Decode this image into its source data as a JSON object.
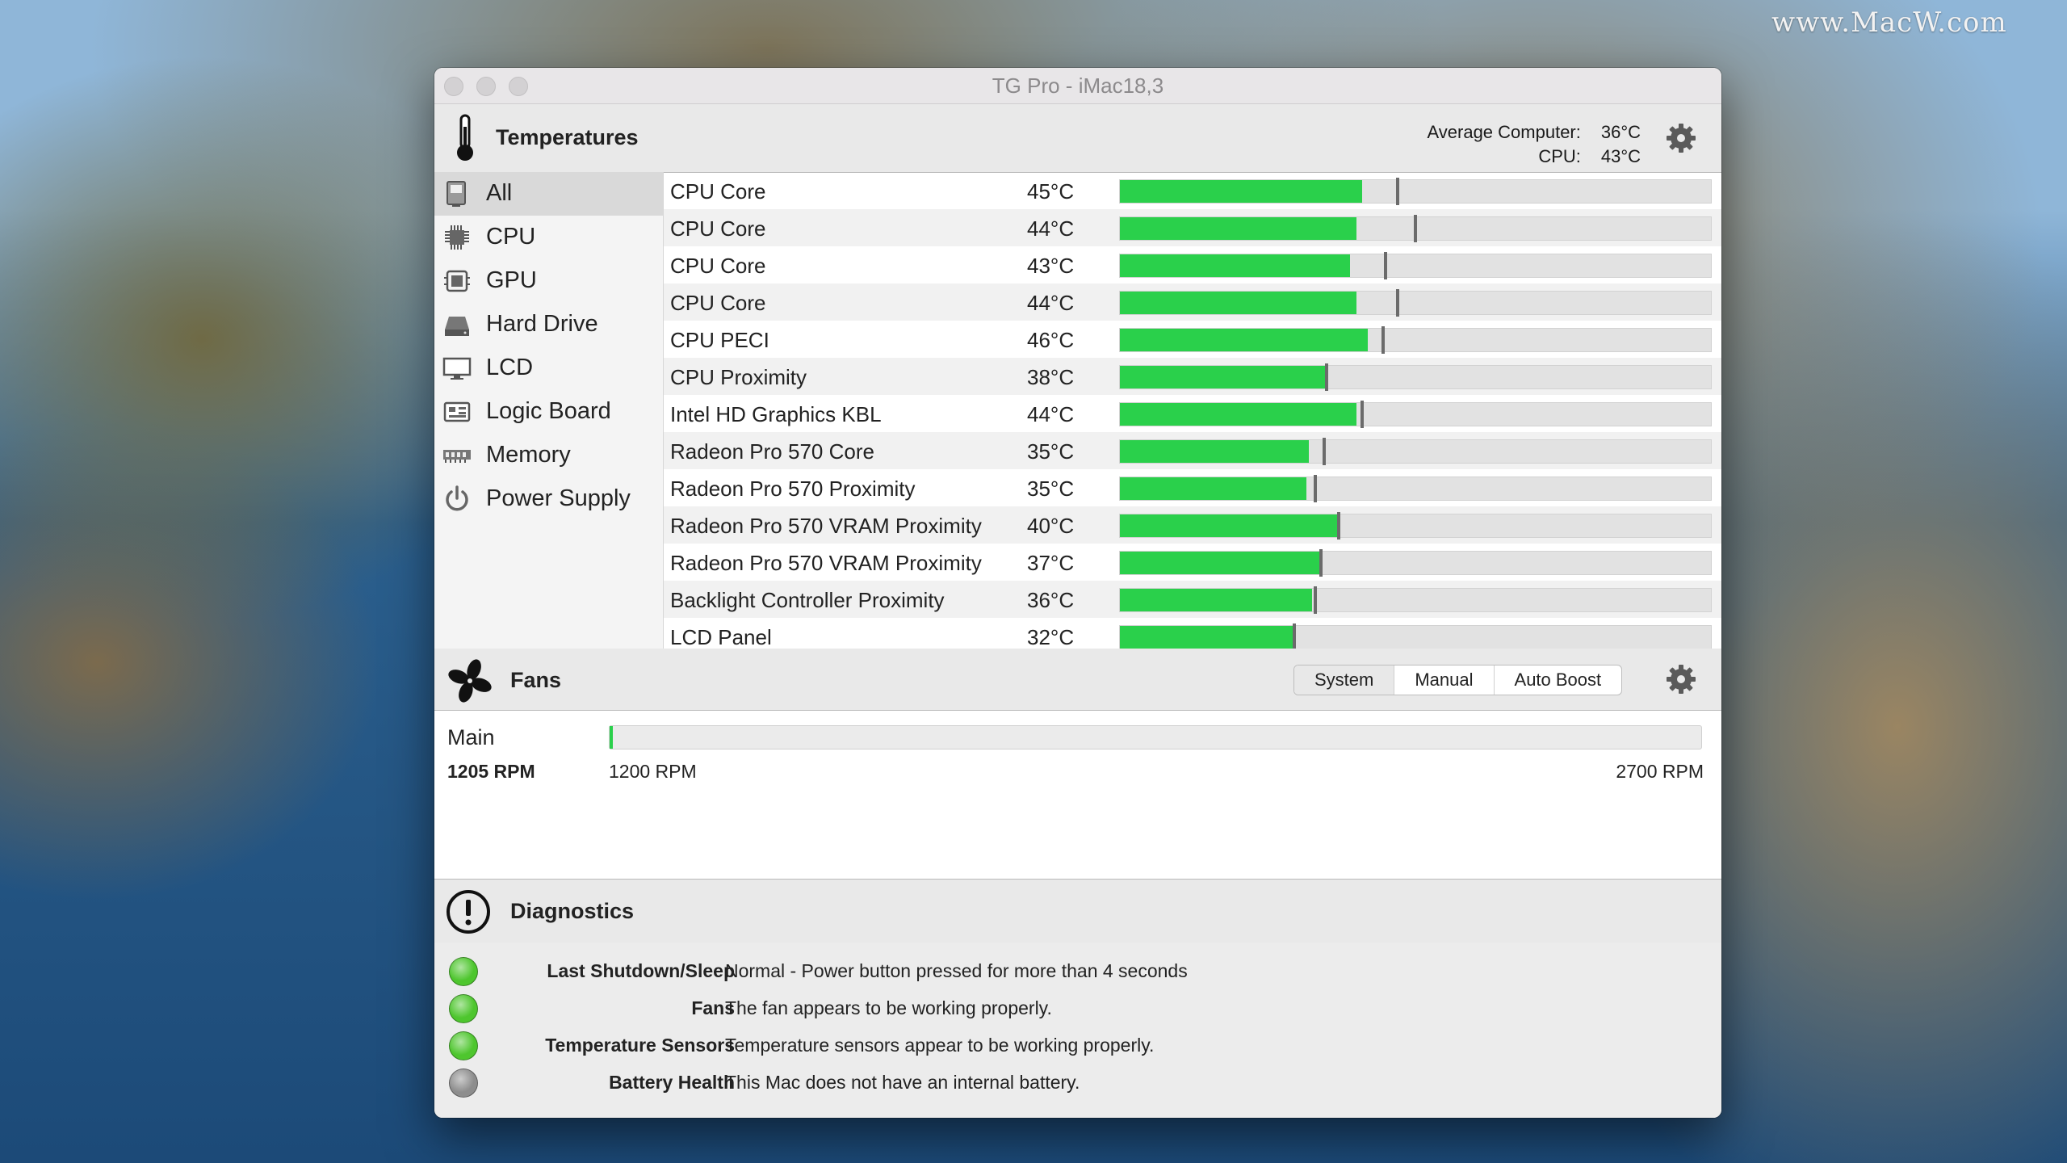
{
  "watermark": "www.MacW.com",
  "window": {
    "title": "TG Pro - iMac18,3"
  },
  "temperatures": {
    "title": "Temperatures",
    "average_label": "Average Computer:",
    "average_value": "36°C",
    "cpu_label": "CPU:",
    "cpu_value": "43°C",
    "categories": [
      {
        "label": "All",
        "icon": "all-icon",
        "active": true
      },
      {
        "label": "CPU",
        "icon": "cpu-icon"
      },
      {
        "label": "GPU",
        "icon": "gpu-icon"
      },
      {
        "label": "Hard Drive",
        "icon": "hard-drive-icon"
      },
      {
        "label": "LCD",
        "icon": "lcd-icon"
      },
      {
        "label": "Logic Board",
        "icon": "logic-board-icon"
      },
      {
        "label": "Memory",
        "icon": "memory-icon"
      },
      {
        "label": "Power Supply",
        "icon": "power-icon"
      }
    ],
    "sensors": [
      {
        "name": "CPU Core",
        "temp": "45°C",
        "level": 0.41,
        "max": 0.47
      },
      {
        "name": "CPU Core",
        "temp": "44°C",
        "level": 0.4,
        "max": 0.5
      },
      {
        "name": "CPU Core",
        "temp": "43°C",
        "level": 0.39,
        "max": 0.45
      },
      {
        "name": "CPU Core",
        "temp": "44°C",
        "level": 0.4,
        "max": 0.47
      },
      {
        "name": "CPU PECI",
        "temp": "46°C",
        "level": 0.42,
        "max": 0.445
      },
      {
        "name": "CPU Proximity",
        "temp": "38°C",
        "level": 0.35,
        "max": 0.35
      },
      {
        "name": "Intel HD Graphics KBL",
        "temp": "44°C",
        "level": 0.4,
        "max": 0.41
      },
      {
        "name": "Radeon Pro 570 Core",
        "temp": "35°C",
        "level": 0.32,
        "max": 0.345
      },
      {
        "name": "Radeon Pro 570 Proximity",
        "temp": "35°C",
        "level": 0.315,
        "max": 0.33
      },
      {
        "name": "Radeon Pro 570 VRAM Proximity",
        "temp": "40°C",
        "level": 0.37,
        "max": 0.37
      },
      {
        "name": "Radeon Pro 570 VRAM Proximity",
        "temp": "37°C",
        "level": 0.34,
        "max": 0.34
      },
      {
        "name": "Backlight Controller Proximity",
        "temp": "36°C",
        "level": 0.325,
        "max": 0.33
      },
      {
        "name": "LCD Panel",
        "temp": "32°C",
        "level": 0.295,
        "max": 0.295
      }
    ]
  },
  "fans": {
    "title": "Fans",
    "modes": [
      "System",
      "Manual",
      "Auto Boost"
    ],
    "active_mode": "System",
    "fan_name": "Main",
    "current_rpm": "1205 RPM",
    "min_rpm": "1200 RPM",
    "max_rpm": "2700 RPM",
    "level": 0.003
  },
  "diagnostics": {
    "title": "Diagnostics",
    "items": [
      {
        "label": "Last Shutdown/Sleep",
        "text": "Normal - Power button pressed for more than 4 seconds",
        "status": "green"
      },
      {
        "label": "Fans",
        "text": "The fan appears to be working properly.",
        "status": "green"
      },
      {
        "label": "Temperature Sensors",
        "text": "Temperature sensors appear to be working properly.",
        "status": "green"
      },
      {
        "label": "Battery Health",
        "text": "This Mac does not have an internal battery.",
        "status": "gray"
      }
    ]
  },
  "colors": {
    "bar_green": "#2ad04b",
    "status_green": "#4ec62e",
    "status_gray": "#8d8d8d"
  }
}
